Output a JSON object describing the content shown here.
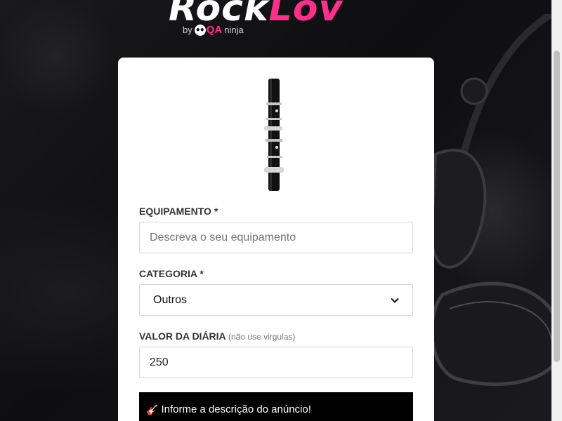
{
  "logo": {
    "part1": "Rock",
    "part2": "Lov",
    "by": "by",
    "qa": "QA",
    "ninja": "ninja"
  },
  "form": {
    "equipamento": {
      "label": "EQUIPAMENTO *",
      "placeholder": "Descreva o seu equipamento",
      "value": ""
    },
    "categoria": {
      "label": "CATEGORIA *",
      "selected": "Outros"
    },
    "valor": {
      "label": "VALOR DA DIÁRIA",
      "hint": "(não use virgulas)",
      "value": "250"
    }
  },
  "toast": {
    "icon": "guitar-icon",
    "message": "Informe a descrição do anúncio!"
  },
  "colors": {
    "brand_pink": "#ff2f8c",
    "toast_bg": "#000000"
  }
}
